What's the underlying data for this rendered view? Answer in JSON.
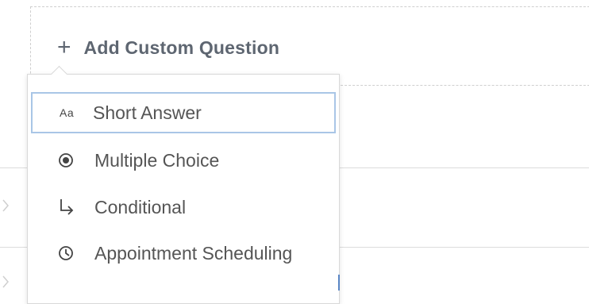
{
  "add_button": {
    "icon": "plus-icon",
    "label": "Add Custom Question"
  },
  "background_rows": [
    {
      "chevron_icon": "chevron-right-icon"
    },
    {
      "chevron_icon": "chevron-right-icon"
    }
  ],
  "menu": {
    "items": [
      {
        "icon": "text-aa-icon",
        "icon_text": "Aa",
        "label": "Short Answer",
        "selected": true
      },
      {
        "icon": "radio-icon",
        "label": "Multiple Choice",
        "selected": false
      },
      {
        "icon": "branch-arrow-icon",
        "label": "Conditional",
        "selected": false
      },
      {
        "icon": "clock-icon",
        "label": "Appointment Scheduling",
        "selected": false
      }
    ]
  },
  "colors": {
    "selected_border": "#a9c6e6",
    "text": "#555555",
    "add_button_text": "#5e6671",
    "focus_edge": "#5a86c5"
  }
}
